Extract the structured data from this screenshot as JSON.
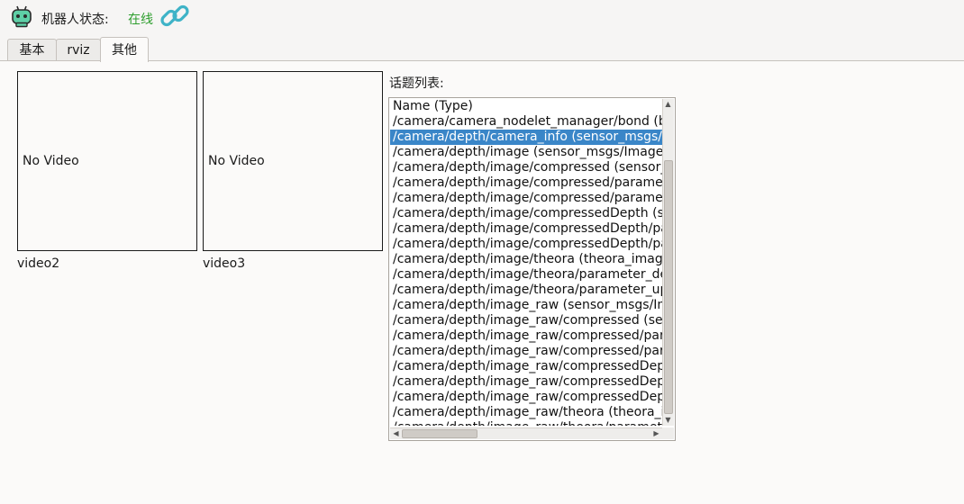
{
  "header": {
    "status_label": "机器人状态:",
    "status_value": "在线",
    "status_color": "#2e9e2e",
    "robot_icon": "robot-icon",
    "link_icon": "link-icon"
  },
  "tabs": [
    {
      "label": "基本",
      "active": false
    },
    {
      "label": "rviz",
      "active": false
    },
    {
      "label": "其他",
      "active": true
    }
  ],
  "videos": [
    {
      "placeholder": "No Video",
      "label": "video2"
    },
    {
      "placeholder": "No Video",
      "label": "video3"
    }
  ],
  "topics": {
    "title": "话题列表:",
    "selected_index": 2,
    "selection_color": "#3a86c8",
    "rows": [
      "Name  (Type)",
      "/camera/camera_nodelet_manager/bond  (bond/Status)",
      "/camera/depth/camera_info  (sensor_msgs/CameraInfo)",
      "/camera/depth/image  (sensor_msgs/Image)",
      "/camera/depth/image/compressed  (sensor_msgs/CompressedImage)",
      "/camera/depth/image/compressed/parameter_descriptions",
      "/camera/depth/image/compressed/parameter_updates",
      "/camera/depth/image/compressedDepth  (sensor_msgs/CompressedImage)",
      "/camera/depth/image/compressedDepth/parameter_descriptions",
      "/camera/depth/image/compressedDepth/parameter_updates",
      "/camera/depth/image/theora  (theora_image_transport/Packet)",
      "/camera/depth/image/theora/parameter_descriptions",
      "/camera/depth/image/theora/parameter_updates",
      "/camera/depth/image_raw  (sensor_msgs/Image)",
      "/camera/depth/image_raw/compressed  (sensor_msgs/CompressedImage)",
      "/camera/depth/image_raw/compressed/parameter_descriptions",
      "/camera/depth/image_raw/compressed/parameter_updates",
      "/camera/depth/image_raw/compressedDepth  (sensor_msgs/CompressedImage)",
      "/camera/depth/image_raw/compressedDepth/parameter_descriptions",
      "/camera/depth/image_raw/compressedDepth/parameter_updates",
      "/camera/depth/image_raw/theora  (theora_image_transport/Packet)",
      "/camera/depth/image_raw/theora/parameter_descriptions"
    ]
  }
}
